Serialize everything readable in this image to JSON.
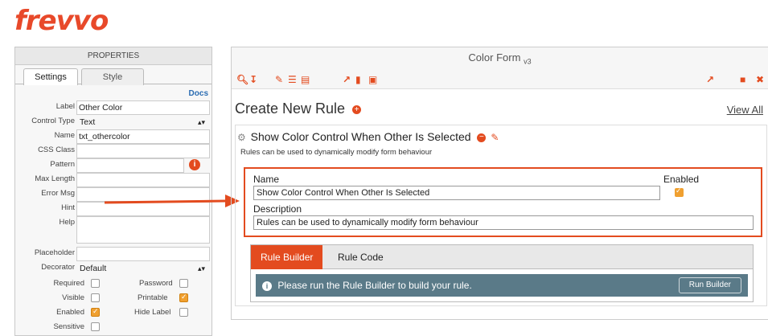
{
  "app": {
    "logo": "frevvo"
  },
  "properties": {
    "header": "PROPERTIES",
    "tabs": [
      "Settings",
      "Style"
    ],
    "docs": "Docs",
    "fields": {
      "label": {
        "label": "Label",
        "value": "Other Color"
      },
      "control_type": {
        "label": "Control Type",
        "value": "Text"
      },
      "name": {
        "label": "Name",
        "value": "txt_othercolor"
      },
      "css_class": {
        "label": "CSS Class",
        "value": ""
      },
      "pattern": {
        "label": "Pattern",
        "value": ""
      },
      "max_length": {
        "label": "Max Length",
        "value": ""
      },
      "error_msg": {
        "label": "Error Msg",
        "value": ""
      },
      "hint": {
        "label": "Hint",
        "value": ""
      },
      "help": {
        "label": "Help",
        "value": ""
      },
      "placeholder": {
        "label": "Placeholder",
        "value": ""
      },
      "decorator": {
        "label": "Decorator",
        "value": "Default"
      }
    },
    "checkboxes": {
      "required": "Required",
      "password": "Password",
      "visible": "Visible",
      "printable": "Printable",
      "enabled": "Enabled",
      "hide_label": "Hide Label",
      "sensitive": "Sensitive"
    }
  },
  "form": {
    "title": "Color Form",
    "version": "v3",
    "heading": "Create New Rule",
    "view_all": "View All",
    "rule": {
      "title": "Show Color Control When Other Is Selected",
      "subtitle": "Rules can be used to dynamically modify form behaviour",
      "name_label": "Name",
      "name_value": "Show Color Control When Other Is Selected",
      "enabled_label": "Enabled",
      "description_label": "Description",
      "description_value": "Rules can be used to dynamically modify form behaviour"
    },
    "builder": {
      "tabs": [
        "Rule Builder",
        "Rule Code"
      ],
      "message": "Please run the Rule Builder to build your rule.",
      "run_button": "Run Builder"
    }
  },
  "colors": {
    "accent": "#e34b1f",
    "info_bar": "#5a7a88",
    "checkbox_on": "#f0a030"
  }
}
